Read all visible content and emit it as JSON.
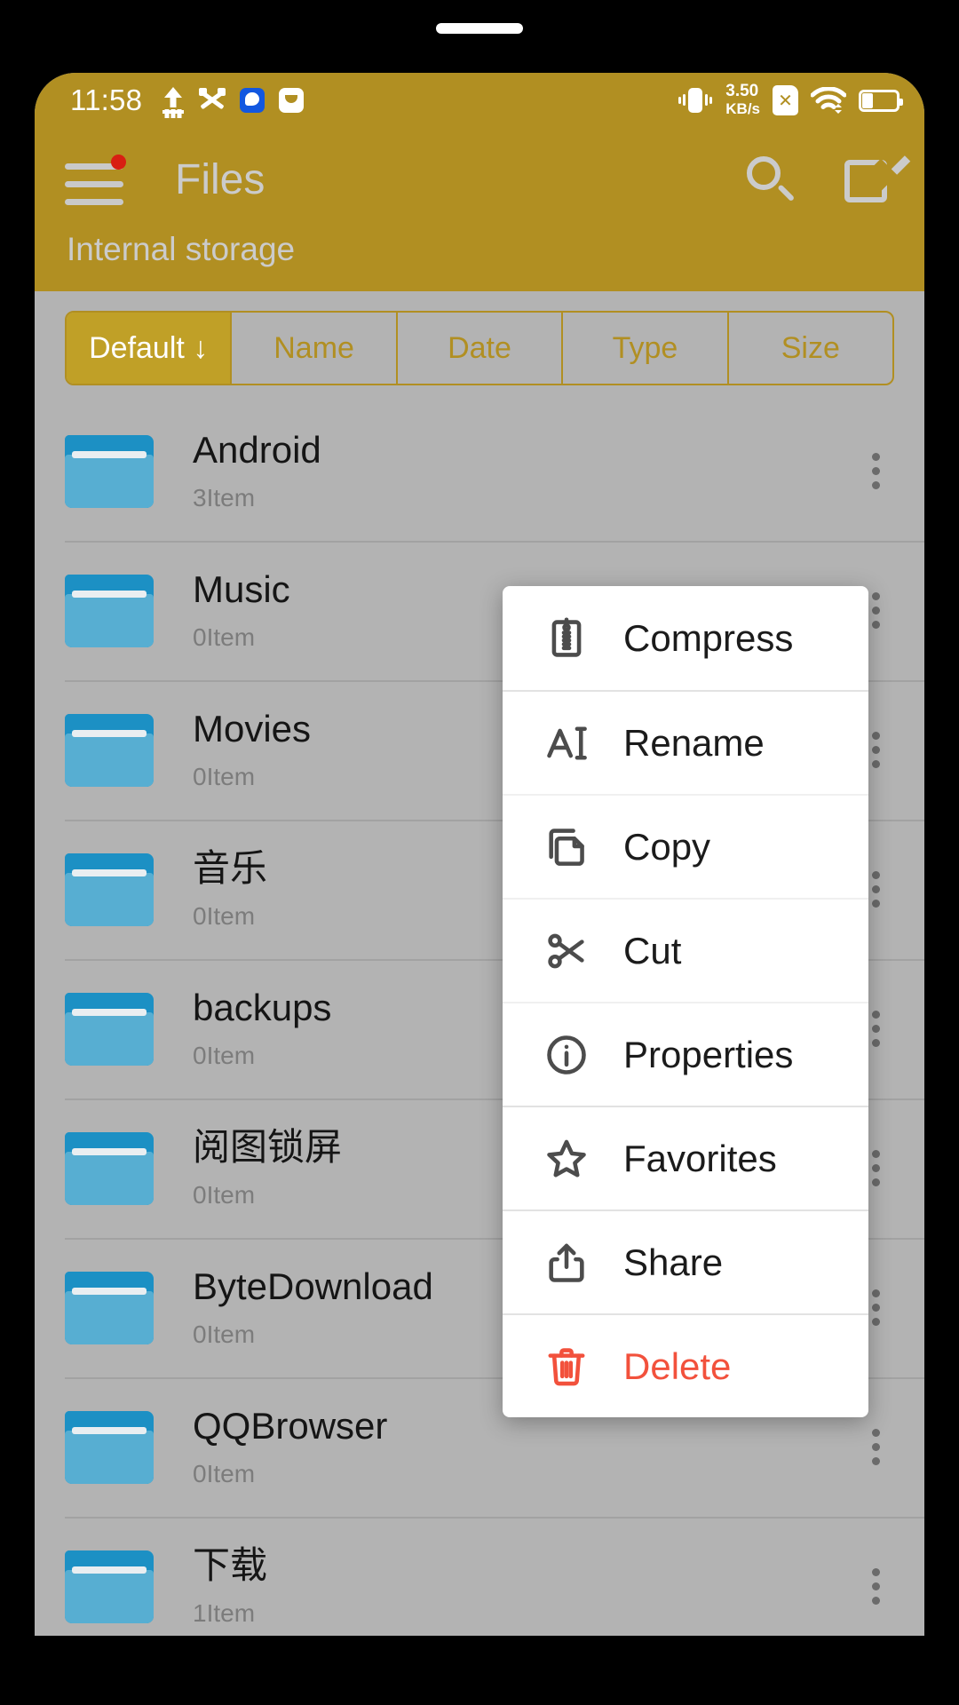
{
  "status_bar": {
    "time": "11:58",
    "left_icons": [
      "upload-icon",
      "tools-icon",
      "blue-app-icon",
      "white-app-icon"
    ],
    "net_speed_value": "3.50",
    "net_speed_unit": "KB/s",
    "right_icons": [
      "vibrate-icon",
      "sim-card-x-icon",
      "wifi-icon",
      "battery-icon"
    ],
    "sim_x_label": "✕"
  },
  "app_bar": {
    "title": "Files",
    "breadcrumb": "Internal storage",
    "menu_badge": true,
    "actions": [
      "search-icon",
      "edit-icon"
    ]
  },
  "sort_tabs": {
    "active_index": 0,
    "items": [
      {
        "label": "Default ↓"
      },
      {
        "label": "Name"
      },
      {
        "label": "Date"
      },
      {
        "label": "Type"
      },
      {
        "label": "Size"
      }
    ]
  },
  "file_list": [
    {
      "name": "Android",
      "sub": "3Item",
      "icon": "folder-icon",
      "menu": true
    },
    {
      "name": "Music",
      "sub": "0Item",
      "icon": "folder-icon",
      "menu": true
    },
    {
      "name": "Movies",
      "sub": "0Item",
      "icon": "folder-icon",
      "menu": true
    },
    {
      "name": "音乐",
      "sub": "0Item",
      "icon": "folder-icon",
      "menu": true
    },
    {
      "name": "backups",
      "sub": "0Item",
      "icon": "folder-icon",
      "menu": true
    },
    {
      "name": "阅图锁屏",
      "sub": "0Item",
      "icon": "folder-icon",
      "menu": true
    },
    {
      "name": "ByteDownload",
      "sub": "0Item",
      "icon": "folder-icon",
      "menu": true
    },
    {
      "name": "QQBrowser",
      "sub": "0Item",
      "icon": "folder-icon",
      "menu": true
    },
    {
      "name": "下载",
      "sub": "1Item",
      "icon": "folder-icon",
      "menu": true
    }
  ],
  "context_menu": {
    "items": [
      {
        "label": "Compress",
        "icon": "zip-icon",
        "group_start": false,
        "danger": false
      },
      {
        "label": "Rename",
        "icon": "rename-icon",
        "group_start": true,
        "danger": false
      },
      {
        "label": "Copy",
        "icon": "copy-icon",
        "group_start": false,
        "danger": false
      },
      {
        "label": "Cut",
        "icon": "scissors-icon",
        "group_start": false,
        "danger": false
      },
      {
        "label": "Properties",
        "icon": "info-icon",
        "group_start": false,
        "danger": false
      },
      {
        "label": "Favorites",
        "icon": "star-icon",
        "group_start": true,
        "danger": false
      },
      {
        "label": "Share",
        "icon": "share-icon",
        "group_start": true,
        "danger": false
      },
      {
        "label": "Delete",
        "icon": "trash-icon",
        "group_start": true,
        "danger": true
      }
    ]
  },
  "colors": {
    "accent_gold": "#b18f22",
    "tab_active": "#c0a027",
    "page_bg": "#b3b3b3",
    "folder_blue": "#57aed2",
    "folder_blue_dark": "#1c90c4",
    "danger_red": "#f2513c",
    "badge_red": "#d81f12"
  }
}
